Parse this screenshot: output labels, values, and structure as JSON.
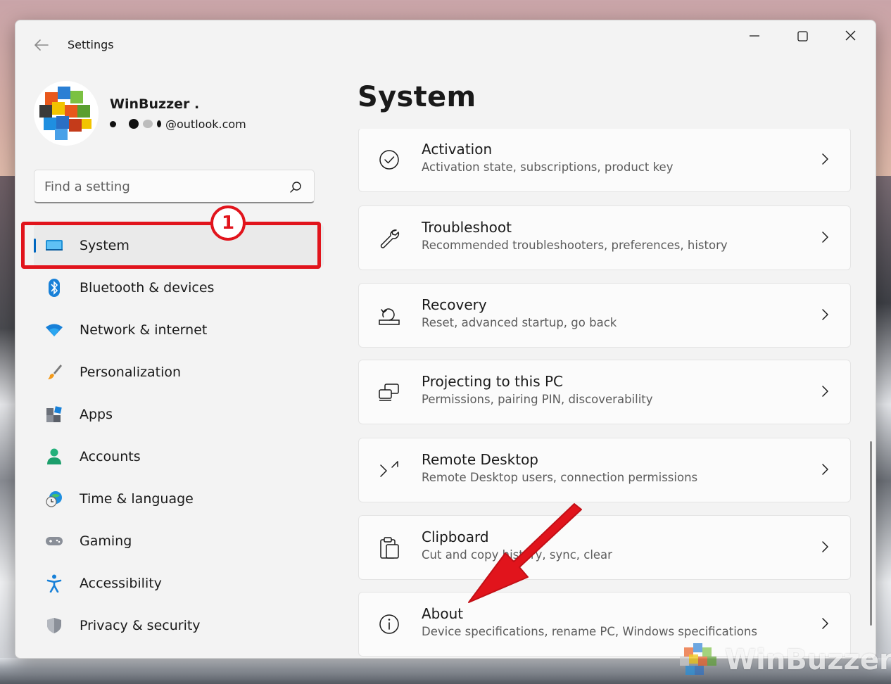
{
  "window": {
    "title": "Settings"
  },
  "profile": {
    "name": "WinBuzzer .",
    "email_suffix": "@outlook.com"
  },
  "search": {
    "placeholder": "Find a setting"
  },
  "nav": {
    "items": [
      {
        "label": "System",
        "icon": "system-display-icon",
        "selected": true
      },
      {
        "label": "Bluetooth & devices",
        "icon": "bluetooth-icon"
      },
      {
        "label": "Network & internet",
        "icon": "wifi-icon"
      },
      {
        "label": "Personalization",
        "icon": "paintbrush-icon"
      },
      {
        "label": "Apps",
        "icon": "apps-icon"
      },
      {
        "label": "Accounts",
        "icon": "person-icon"
      },
      {
        "label": "Time & language",
        "icon": "globe-clock-icon"
      },
      {
        "label": "Gaming",
        "icon": "gamepad-icon"
      },
      {
        "label": "Accessibility",
        "icon": "accessibility-icon"
      },
      {
        "label": "Privacy & security",
        "icon": "shield-icon"
      }
    ]
  },
  "annotation": {
    "step_number": "1",
    "color": "#e1141c"
  },
  "page": {
    "title": "System"
  },
  "settings": [
    {
      "title": "Activation",
      "subtitle": "Activation state, subscriptions, product key",
      "icon": "check-circle-icon"
    },
    {
      "title": "Troubleshoot",
      "subtitle": "Recommended troubleshooters, preferences, history",
      "icon": "wrench-icon"
    },
    {
      "title": "Recovery",
      "subtitle": "Reset, advanced startup, go back",
      "icon": "recovery-icon"
    },
    {
      "title": "Projecting to this PC",
      "subtitle": "Permissions, pairing PIN, discoverability",
      "icon": "project-screen-icon"
    },
    {
      "title": "Remote Desktop",
      "subtitle": "Remote Desktop users, connection permissions",
      "icon": "remote-desktop-icon"
    },
    {
      "title": "Clipboard",
      "subtitle": "Cut and copy history, sync, clear",
      "icon": "clipboard-icon"
    },
    {
      "title": "About",
      "subtitle": "Device specifications, rename PC, Windows specifications",
      "icon": "info-icon"
    }
  ],
  "watermark": {
    "text": "WinBuzzer"
  },
  "colors": {
    "accent": "#0067c0",
    "window_bg": "#f3f3f3",
    "card_bg": "#fbfbfb"
  }
}
